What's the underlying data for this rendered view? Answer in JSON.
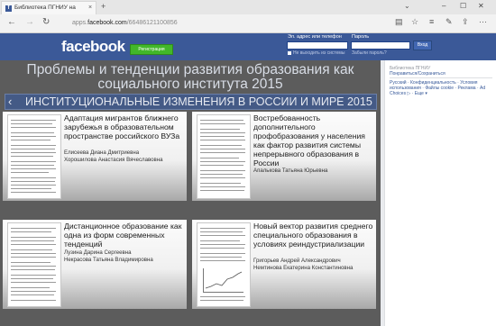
{
  "browser": {
    "tab_title": "Библиотека ПГНИУ на",
    "tab_close": "×",
    "new_tab": "+",
    "url_prefix": "apps.",
    "url_domain": "facebook.com",
    "url_path": "/66486121100856"
  },
  "facebook": {
    "logo": "facebook",
    "register_button": "Регистрация",
    "email_label": "Эл. адрес или телефон",
    "password_label": "Пароль",
    "login_button": "Вход",
    "keep_logged_in": "Не выходить из системы",
    "forgot_password": "Забыли пароль?"
  },
  "main": {
    "title": "Проблемы и тенденции развития образования как социального института 2015",
    "subtitle": "ИНСТИТУЦИОНАЛЬНЫЕ ИЗМЕНЕНИЯ В РОССИИ И МИРЕ 2015",
    "back_symbol": "‹",
    "cards": [
      {
        "title": "Адаптация мигрантов ближнего зарубежья в образовательном пространстве российского ВУЗа",
        "authors": [
          "Елисеева Диана Дмитриевна",
          "Хорошилова Анастасия Вячеславовна"
        ]
      },
      {
        "title": "Востребованность дополнительного профобразования у населения как фактор развития системы непрерывного образования в России",
        "authors": [
          "Апалькова Татьяна Юрьевна"
        ]
      },
      {
        "title": "Дистанционное образование как одна из форм современных тенденций",
        "authors": [
          "Лузина Дарина Сергеевна",
          "Некрасова Татьяна Владимировна"
        ]
      },
      {
        "title": "Новый вектор развития среднего специального образования в условиях реиндустриализации",
        "authors": [
          "Григорьев Андрей Александрович",
          "Немтинова Екатерина Константиновна"
        ]
      }
    ]
  },
  "sidebar": {
    "app_name": "Библиотека ПГНИУ",
    "like_link": "Понравиться/Сохраниться",
    "links": [
      "Русский",
      "Конфиденциальность",
      "Условия использования",
      "Файлы cookie",
      "Реклама",
      "Ad Choices",
      "Еще"
    ]
  },
  "colors": {
    "facebook_blue": "#3b5998",
    "register_green": "#42b72a",
    "content_bg": "#5c5c5c"
  },
  "icons": [
    "back-icon",
    "forward-icon",
    "refresh-icon",
    "reading-view-icon",
    "favorite-icon",
    "hub-icon",
    "notes-icon",
    "share-icon",
    "more-icon"
  ]
}
